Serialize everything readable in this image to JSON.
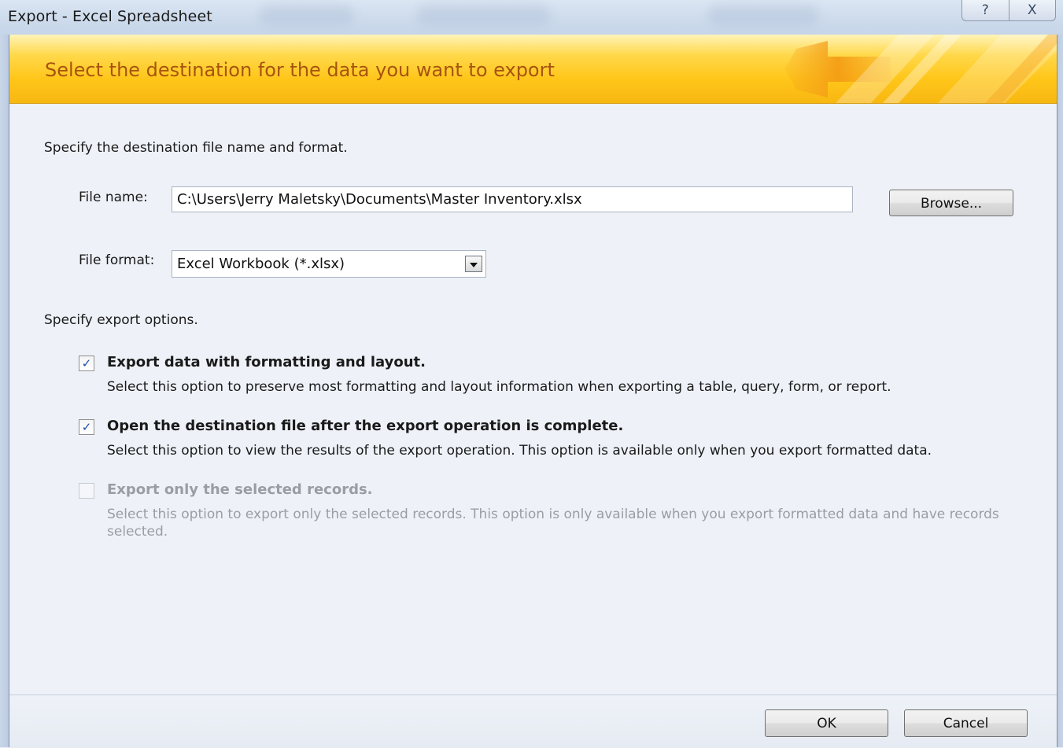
{
  "window": {
    "title": "Export - Excel Spreadsheet",
    "help_glyph": "?",
    "close_glyph": "X"
  },
  "banner": {
    "title": "Select the destination for the data you want to export"
  },
  "destination": {
    "instruction": "Specify the destination file name and format.",
    "file_name_label": "File name:",
    "file_name_value": "C:\\Users\\Jerry Maletsky\\Documents\\Master Inventory.xlsx",
    "browse_label": "Browse...",
    "file_format_label": "File format:",
    "file_format_value": "Excel Workbook (*.xlsx)"
  },
  "options": {
    "instruction": "Specify export options.",
    "items": [
      {
        "title": "Export data with formatting and layout.",
        "description": "Select this option to preserve most formatting and layout information when exporting a table, query, form, or report.",
        "checked": true,
        "enabled": true
      },
      {
        "title": "Open the destination file after the export operation is complete.",
        "description": "Select this option to view the results of the export operation. This option is available only when you export formatted data.",
        "checked": true,
        "enabled": true
      },
      {
        "title": "Export only the selected records.",
        "description": "Select this option to export only the selected records. This option is only available when you export formatted data and have records selected.",
        "checked": false,
        "enabled": false
      }
    ]
  },
  "footer": {
    "ok_label": "OK",
    "cancel_label": "Cancel"
  },
  "colors": {
    "banner_text": "#a8530f",
    "banner_gold": "#ffc619",
    "check_mark": "#1d4fa6",
    "disabled_text": "#9a9da3"
  },
  "icons": {
    "check": "✓"
  }
}
